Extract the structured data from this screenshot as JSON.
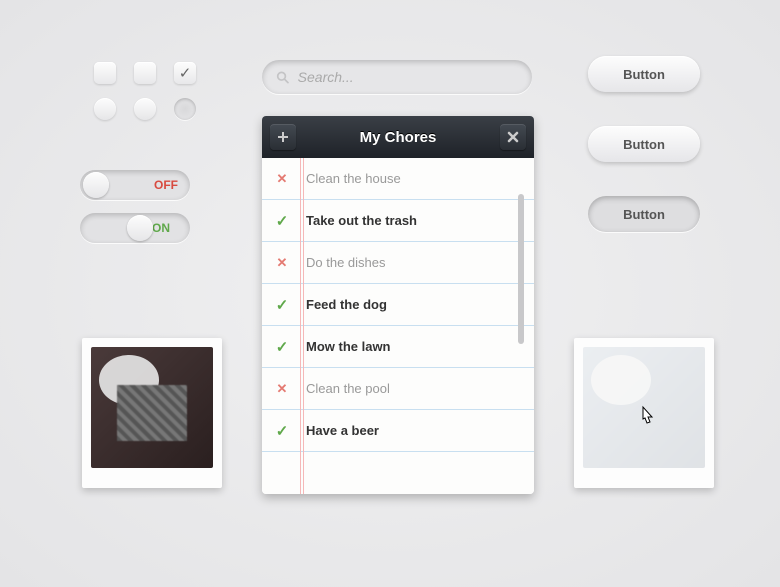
{
  "toggles": {
    "off_label": "OFF",
    "on_label": "ON"
  },
  "search": {
    "placeholder": "Search..."
  },
  "buttons": {
    "b1": "Button",
    "b2": "Button",
    "b3": "Button"
  },
  "chores": {
    "title": "My Chores",
    "items": [
      {
        "done": false,
        "text": "Clean the house"
      },
      {
        "done": true,
        "text": "Take out the trash"
      },
      {
        "done": false,
        "text": "Do the dishes"
      },
      {
        "done": true,
        "text": "Feed the dog"
      },
      {
        "done": true,
        "text": "Mow the lawn"
      },
      {
        "done": false,
        "text": "Clean the pool"
      },
      {
        "done": true,
        "text": "Have a beer"
      }
    ]
  }
}
